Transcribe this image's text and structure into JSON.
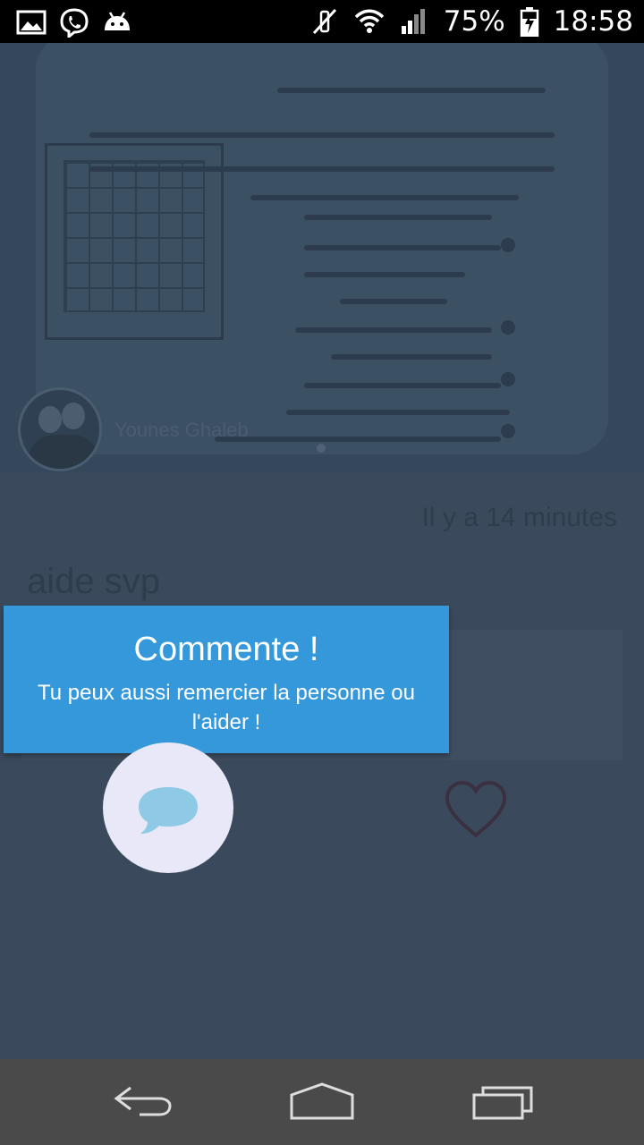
{
  "status_bar": {
    "battery": "75%",
    "time": "18:58",
    "icons": [
      "gallery-icon",
      "viber-icon",
      "android-icon",
      "mute-icon",
      "wifi-icon",
      "signal-icon",
      "battery-charging-icon"
    ]
  },
  "post": {
    "author": "Younes Ghaleb",
    "timestamp": "Il y a 14 minutes",
    "title": "aide svp"
  },
  "tooltip": {
    "title": "Commente !",
    "body": "Tu peux aussi remercier la personne ou l'aider !"
  },
  "colors": {
    "tooltip_bg": "#3498db",
    "overlay": "#3a4a5c",
    "comment_icon": "#8ecae6",
    "highlight_bg": "#e8e8f8",
    "status_bar": "#000000",
    "nav_bar": "#4a4a4a"
  },
  "nav": {
    "icons": [
      "back-icon",
      "home-icon",
      "recents-icon"
    ]
  }
}
